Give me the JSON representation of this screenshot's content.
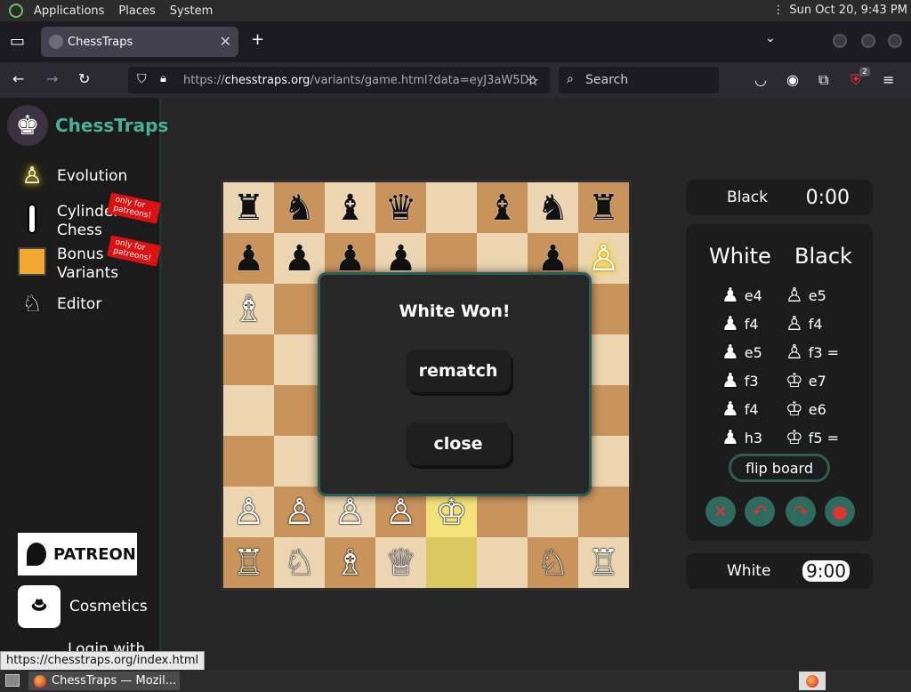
{
  "topbar": {
    "menu": [
      "Applications",
      "Places",
      "System"
    ],
    "clock": "Sun Oct 20,  9:43 PM"
  },
  "browser": {
    "tab_title": "ChessTraps",
    "url_prefix": "https://",
    "url_host": "chesstraps.org",
    "url_path": "/variants/game.html?data=eyJ3aW5Db",
    "search_placeholder": "Search",
    "extension_badge": "2"
  },
  "sidebar": {
    "brand": "ChessTraps",
    "items": [
      {
        "label": "Evolution",
        "icon": "glowing-pawn-icon"
      },
      {
        "label_line1": "Cylinder",
        "label_line2": "Chess",
        "icon": "cylinder-icon",
        "ribbon": "only for patreons!"
      },
      {
        "label_line1": "Bonus",
        "label_line2": "Variants",
        "icon": "bonus-box-icon",
        "ribbon": "only for patreons!"
      },
      {
        "label": "Editor",
        "icon": "editor-piece-icon"
      }
    ],
    "patreon": "PATREON",
    "cosmetics": "Cosmetics",
    "login": "Login with"
  },
  "board": {
    "colors": {
      "light": "#ecd6b1",
      "dark": "#c8945c",
      "highlight": "#f3e27a"
    },
    "ranks": [
      [
        "br",
        "bn",
        "bb",
        "bq",
        "",
        "bb",
        "bn",
        "br"
      ],
      [
        "bp",
        "bp",
        "bp",
        "bp",
        "",
        "",
        "bp",
        "gp"
      ],
      [
        "wb",
        "",
        "",
        "",
        "",
        "",
        "",
        ""
      ],
      [
        "",
        "",
        "",
        "",
        "",
        "",
        "",
        ""
      ],
      [
        "",
        "",
        "",
        "",
        "",
        "",
        "",
        ""
      ],
      [
        "",
        "",
        "",
        "",
        "",
        "",
        "",
        ""
      ],
      [
        "wp",
        "wp",
        "wp",
        "wp",
        "wk",
        "",
        "",
        ""
      ],
      [
        "wr",
        "wn",
        "wb",
        "wq",
        "",
        "",
        "wn",
        "wr"
      ]
    ]
  },
  "modal": {
    "title": "White Won!",
    "rematch": "rematch",
    "close": "close"
  },
  "clocks": {
    "black_label": "Black",
    "black_time": "0:00",
    "white_label": "White",
    "white_time": "9:00"
  },
  "moves": {
    "white_header": "White",
    "black_header": "Black",
    "list": [
      {
        "w": "e4",
        "b": "e5"
      },
      {
        "w": "f4",
        "b": "f4"
      },
      {
        "w": "e5",
        "b": "f3 ="
      },
      {
        "w": "f3",
        "b": "e7"
      },
      {
        "w": "f4",
        "b": "e6"
      },
      {
        "w": "h3",
        "b": "f5 ="
      }
    ],
    "flip": "flip board"
  },
  "statusbar": "https://chesstraps.org/index.html",
  "taskbar": {
    "task": "ChessTraps — Mozil..."
  }
}
